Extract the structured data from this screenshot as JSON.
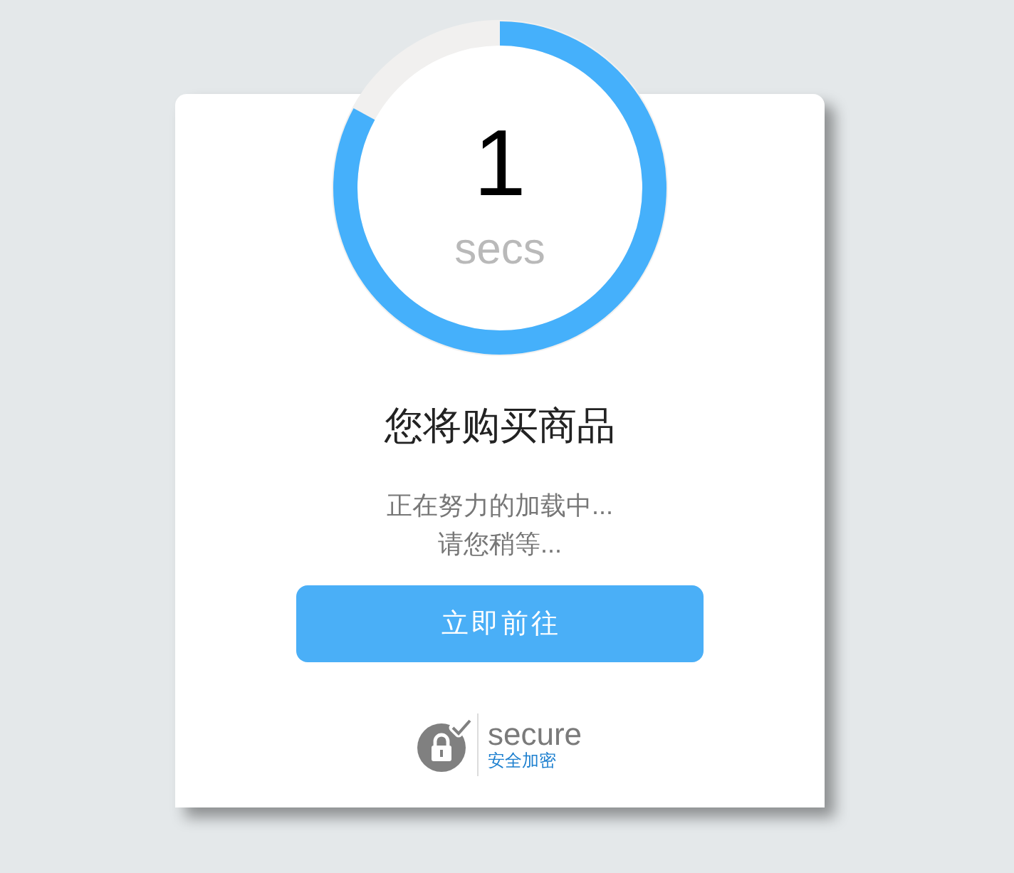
{
  "countdown": {
    "value": "1",
    "unit": "secs",
    "level": 0.83
  },
  "title": "您将购买商品",
  "messages": [
    "正在努力的加载中...",
    "请您稍等..."
  ],
  "button": {
    "label": "立即前往"
  },
  "secure_badge": {
    "label": "secure",
    "sublabel": "安全加密"
  }
}
